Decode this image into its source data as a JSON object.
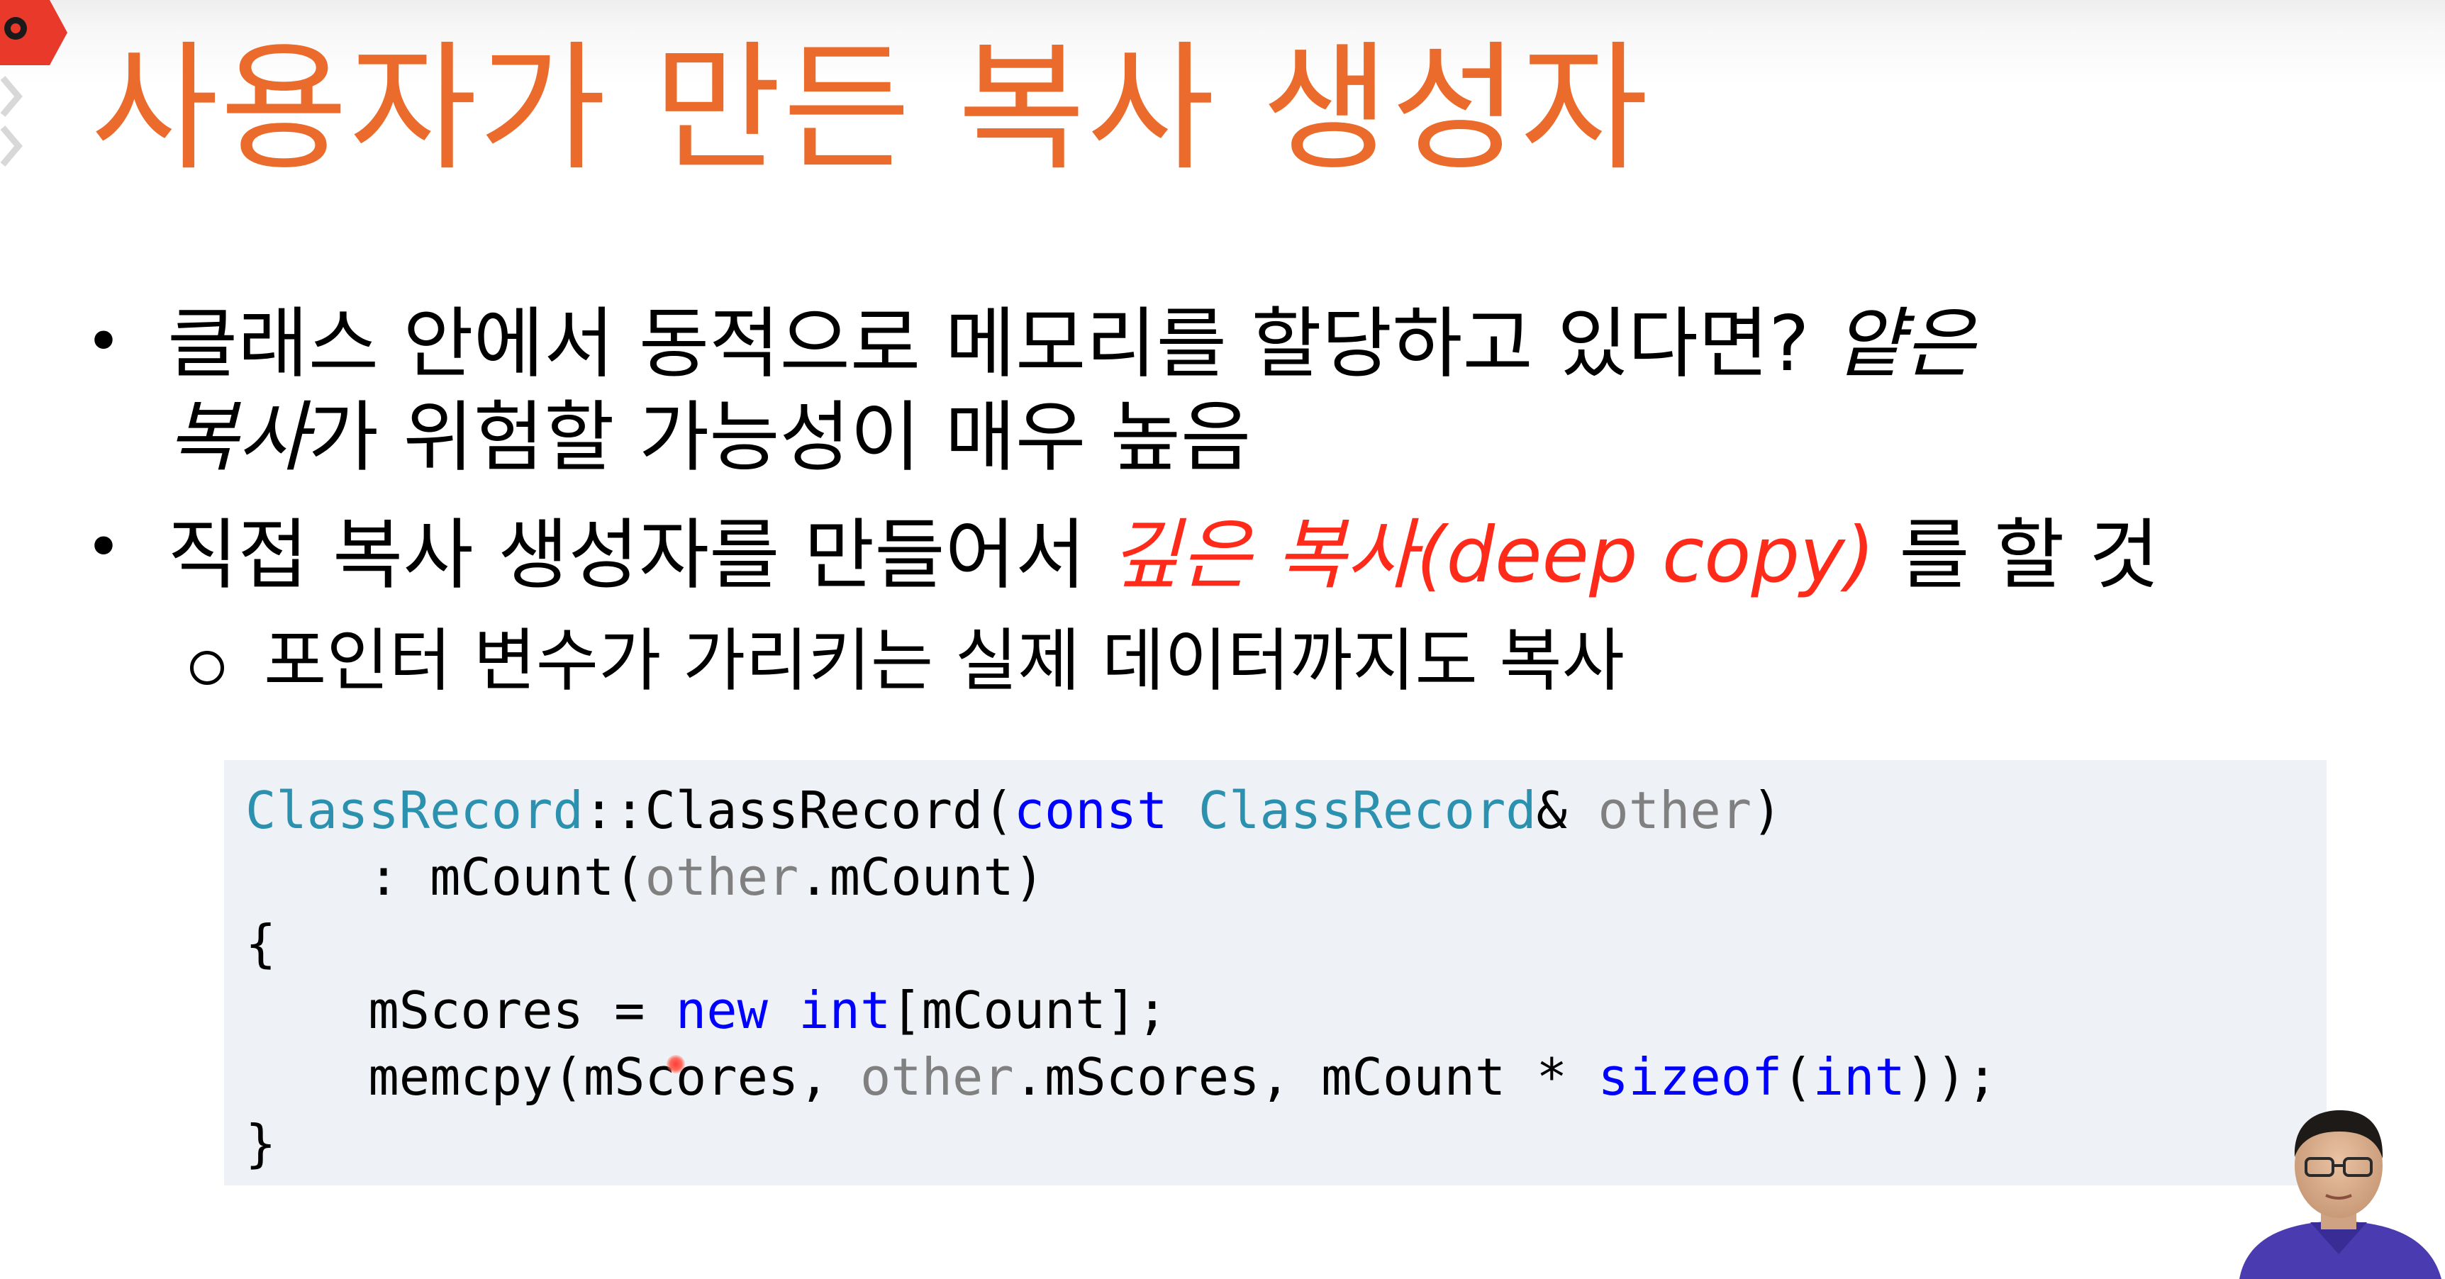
{
  "slide": {
    "title": "사용자가 만든 복사 생성자",
    "bullets": [
      {
        "line1_text": "클래스 안에서 동적으로 메모리를 할당하고 있다면? ",
        "line1_italic": "얕은",
        "line2_italic": "복사",
        "line2_text": "가 위험할 가능성이 매우 높음"
      },
      {
        "text_before": "직접 복사 생성자를 만들어서 ",
        "red_italic": "깊은 복사(deep copy)",
        "text_after": " 를 할 것",
        "sub_bullet": "포인터 변수가 가리키는 실제 데이터까지도 복사"
      }
    ],
    "code": {
      "line1": {
        "type1": "ClassRecord",
        "text1": "::ClassRecord(",
        "kw1": "const",
        "sp1": " ",
        "type2": "ClassRecord",
        "text2": "& ",
        "param1": "other",
        "text3": ")"
      },
      "line2": {
        "text1": "    : mCount(",
        "param1": "other",
        "text2": ".mCount)"
      },
      "line3": {
        "text1": "{"
      },
      "line4": {
        "text1": "    mScores = ",
        "kw1": "new",
        "sp1": " ",
        "kw2": "int",
        "text2": "[mCount];"
      },
      "line5": {
        "text1": "    memcpy(mScores, ",
        "param1": "other",
        "text2": ".mScores, mCount * ",
        "kw1": "sizeof",
        "text3": "(",
        "kw2": "int",
        "text4": "));"
      },
      "line6": {
        "text1": "}"
      }
    }
  },
  "colors": {
    "title": "#ea6b2b",
    "emphasis": "#ff2b1a",
    "keyword": "#0000ff",
    "type": "#2b91af",
    "parameter": "#808080",
    "code_background": "#eef1f6"
  },
  "icons": {
    "corner_badge": "red-play-badge-icon",
    "side_markers": "chevron-right-icon",
    "bullet": "bullet-dot-icon",
    "sub_bullet": "hollow-circle-icon"
  }
}
